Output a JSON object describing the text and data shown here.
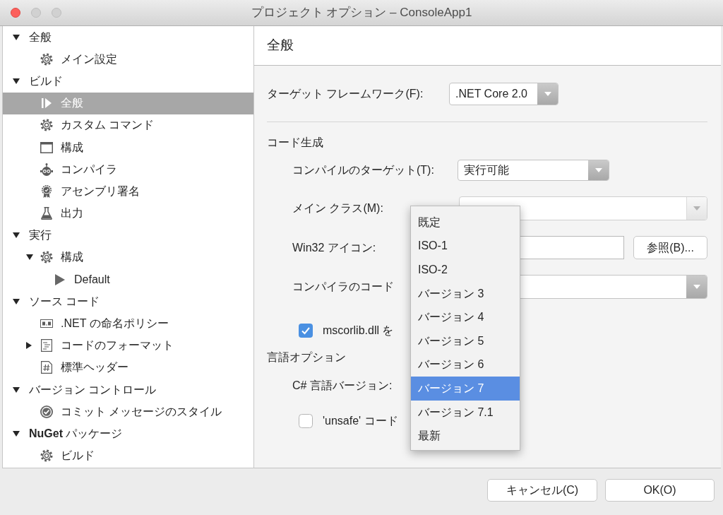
{
  "window": {
    "title": "プロジェクト オプション – ConsoleApp1",
    "traffic_lights": [
      {
        "disabled": false
      },
      {
        "disabled": true
      },
      {
        "disabled": true
      }
    ]
  },
  "sidebar": {
    "items": [
      {
        "label": "全般",
        "expanded": true,
        "selected": false,
        "children": [
          {
            "label": "メイン設定",
            "selected": false
          }
        ]
      },
      {
        "label": "ビルド",
        "expanded": true,
        "selected": false,
        "children": [
          {
            "label": "全般",
            "selected": true
          },
          {
            "label": "カスタム コマンド",
            "selected": false
          },
          {
            "label": "構成",
            "selected": false
          },
          {
            "label": "コンパイラ",
            "selected": false
          },
          {
            "label": "アセンブリ署名",
            "selected": false
          },
          {
            "label": "出力",
            "selected": false
          }
        ]
      },
      {
        "label": "実行",
        "expanded": true,
        "selected": false,
        "children": [
          {
            "label": "構成",
            "expanded": true,
            "selected": false,
            "children": [
              {
                "label": "Default",
                "selected": false
              }
            ]
          }
        ]
      },
      {
        "label": "ソース コード",
        "expanded": true,
        "selected": false,
        "children": [
          {
            "label": ".NET の命名ポリシー",
            "selected": false
          },
          {
            "label": "コードのフォーマット",
            "expanded": false,
            "selected": false
          },
          {
            "label": "標準ヘッダー",
            "selected": false
          }
        ]
      },
      {
        "label": "バージョン コントロール",
        "expanded": true,
        "selected": false,
        "children": [
          {
            "label": "コミット メッセージのスタイル",
            "selected": false
          }
        ]
      },
      {
        "label": "**NuGet** パッケージ",
        "expanded": true,
        "selected": false,
        "children": [
          {
            "label": "ビルド",
            "selected": false
          }
        ]
      }
    ]
  },
  "panel": {
    "title": "全般",
    "framework": {
      "label": "ターゲット フレームワーク(F):",
      "value": ".NET Core 2.0"
    },
    "sections": [
      {
        "title": "コード生成",
        "rows": [
          {
            "kind": "dropdown",
            "label": "コンパイルのターゲット(T):",
            "value": "実行可能"
          },
          {
            "kind": "combo",
            "label": "メイン クラス(M):"
          },
          {
            "kind": "file",
            "label": "Win32 アイコン:",
            "button": "参照(B)..."
          },
          {
            "kind": "dropdown",
            "label": "コンパイラのコード"
          },
          {
            "kind": "checkbox",
            "label": "mscorlib.dll を",
            "checked": true
          }
        ]
      },
      {
        "title": "言語オプション",
        "rows": [
          {
            "kind": "open_dropdown",
            "label": "C# 言語バージョン:",
            "options": [
              {
                "label": "既定",
                "selected": false
              },
              {
                "label": "ISO-1",
                "selected": false
              },
              {
                "label": "ISO-2",
                "selected": false
              },
              {
                "label": "バージョン 3",
                "selected": false
              },
              {
                "label": "バージョン 4",
                "selected": false
              },
              {
                "label": "バージョン 5",
                "selected": false
              },
              {
                "label": "バージョン 6",
                "selected": false
              },
              {
                "label": "バージョン 7",
                "selected": true
              },
              {
                "label": "バージョン 7.1",
                "selected": false
              },
              {
                "label": "最新",
                "selected": false
              }
            ]
          },
          {
            "kind": "checkbox",
            "label": "'unsafe' コード",
            "checked": false
          }
        ]
      }
    ]
  },
  "buttons": [
    {
      "label": "キャンセル(C)"
    },
    {
      "label": "OK(O)"
    }
  ]
}
